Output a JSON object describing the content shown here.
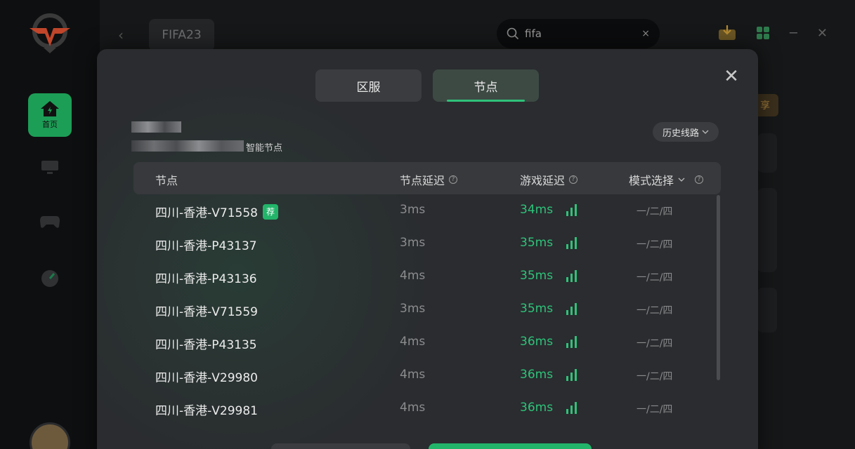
{
  "sidebar": {
    "home_label": "首页",
    "icons": [
      "home-icon",
      "monitor-icon",
      "gamepad-icon",
      "speed-icon"
    ]
  },
  "topbar": {
    "game_tab": "FIFA23",
    "search_value": "fifa",
    "clear_icon": "×",
    "back_icon": "‹",
    "share_text": "享"
  },
  "modal": {
    "tabs": [
      {
        "label": "区服",
        "active": false
      },
      {
        "label": "节点",
        "active": true
      }
    ],
    "smart_node_label": "智能节点",
    "history_label": "历史线路",
    "close_icon": "✕",
    "table": {
      "headers": {
        "node": "节点",
        "node_delay": "节点延迟",
        "game_delay": "游戏延迟",
        "mode_select": "模式选择"
      },
      "recommend_badge": "荐",
      "rows": [
        {
          "name": "四川-香港-V71558",
          "node_delay": "3ms",
          "game_delay": "34ms",
          "mode": "一/二/四",
          "recommended": true
        },
        {
          "name": "四川-香港-P43137",
          "node_delay": "3ms",
          "game_delay": "35ms",
          "mode": "一/二/四",
          "recommended": false
        },
        {
          "name": "四川-香港-P43136",
          "node_delay": "4ms",
          "game_delay": "35ms",
          "mode": "一/二/四",
          "recommended": false
        },
        {
          "name": "四川-香港-V71559",
          "node_delay": "3ms",
          "game_delay": "35ms",
          "mode": "一/二/四",
          "recommended": false
        },
        {
          "name": "四川-香港-P43135",
          "node_delay": "4ms",
          "game_delay": "36ms",
          "mode": "一/二/四",
          "recommended": false
        },
        {
          "name": "四川-香港-V29980",
          "node_delay": "4ms",
          "game_delay": "36ms",
          "mode": "一/二/四",
          "recommended": false
        },
        {
          "name": "四川-香港-V29981",
          "node_delay": "4ms",
          "game_delay": "36ms",
          "mode": "一/二/四",
          "recommended": false
        }
      ]
    }
  },
  "colors": {
    "accent_green": "#2fc27a",
    "home_green": "#1d9e57",
    "modal_bg": "#2a2c2f"
  }
}
